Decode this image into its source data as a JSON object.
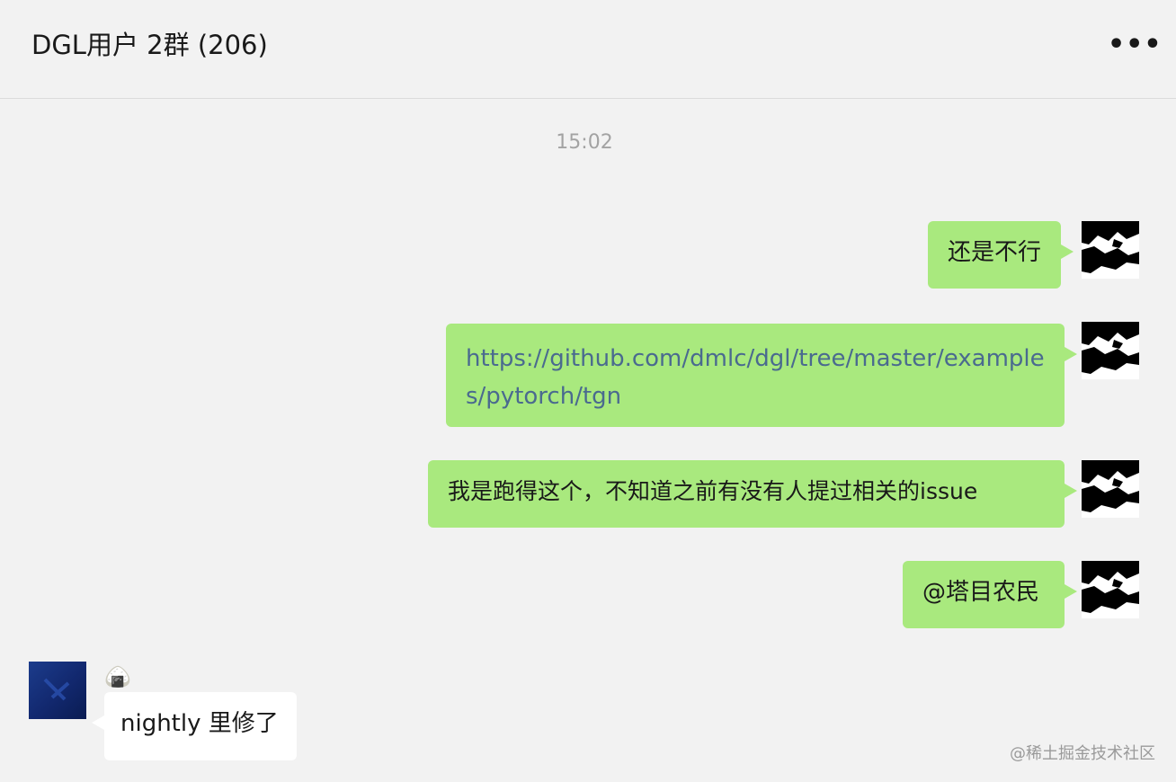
{
  "header": {
    "title": "DGL用户 2群 (206)",
    "more_icon": "more-horizontal-icon",
    "more_glyph": "•••"
  },
  "chat": {
    "timestamp": "15:02",
    "messages": [
      {
        "side": "right",
        "text": "还是不行"
      },
      {
        "side": "right",
        "text": "https://github.com/dmlc/dgl/tree/master/examples/pytorch/tgn",
        "type": "link"
      },
      {
        "side": "right",
        "text": "我是跑得这个，不知道之前有没有人提过相关的issue"
      },
      {
        "side": "right",
        "text": "@塔目农民"
      },
      {
        "side": "left",
        "sender_icon": "rice-ball-icon",
        "sender_glyph": "🍙",
        "text": "nightly 里修了"
      }
    ]
  },
  "watermark": "@稀土掘金技术社区",
  "colors": {
    "background": "#f2f2f2",
    "outgoing_bubble": "#a9e97e",
    "incoming_bubble": "#ffffff",
    "link_text": "#4a6a8f",
    "timestamp": "#a3a3a3"
  }
}
